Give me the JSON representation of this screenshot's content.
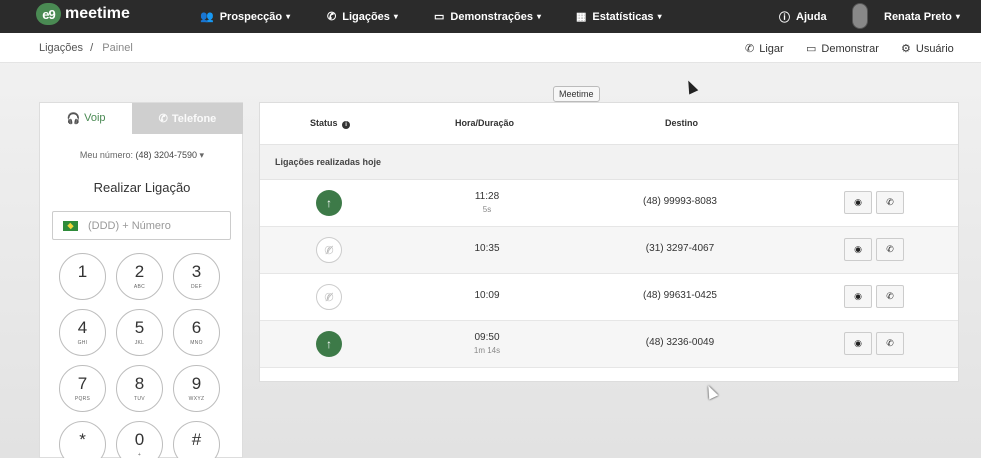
{
  "app": {
    "logo_mark": "e9",
    "logo_text": "meetime"
  },
  "nav": {
    "items": [
      {
        "label": "Prospecção",
        "icon": "users-icon"
      },
      {
        "label": "Ligações",
        "icon": "phone-icon"
      },
      {
        "label": "Demonstrações",
        "icon": "monitor-icon"
      },
      {
        "label": "Estatísticas",
        "icon": "chart-icon"
      }
    ],
    "help": "Ajuda",
    "user": "Renata Preto"
  },
  "breadcrumb": {
    "parent": "Ligações",
    "separator": "/",
    "current": "Painel"
  },
  "actions": {
    "call": "Ligar",
    "demo": "Demonstrar",
    "user": "Usuário"
  },
  "tooltip": "Meetime",
  "dialer": {
    "tabs": [
      {
        "label": "Voip"
      },
      {
        "label": "Telefone"
      }
    ],
    "my_number_label": "Meu número:",
    "my_number": "(48) 3204-7590",
    "title": "Realizar Ligação",
    "input_placeholder": "(DDD) + Número",
    "keys": [
      {
        "digit": "1",
        "letters": ""
      },
      {
        "digit": "2",
        "letters": "ABC"
      },
      {
        "digit": "3",
        "letters": "DEF"
      },
      {
        "digit": "4",
        "letters": "GHI"
      },
      {
        "digit": "5",
        "letters": "JKL"
      },
      {
        "digit": "6",
        "letters": "MNO"
      },
      {
        "digit": "7",
        "letters": "PQRS"
      },
      {
        "digit": "8",
        "letters": "TUV"
      },
      {
        "digit": "9",
        "letters": "WXYZ"
      },
      {
        "digit": "*",
        "letters": ""
      },
      {
        "digit": "0",
        "letters": "+"
      },
      {
        "digit": "#",
        "letters": ""
      }
    ]
  },
  "calls": {
    "headers": {
      "status": "Status",
      "time": "Hora/Duração",
      "destination": "Destino"
    },
    "group_label": "Ligações realizadas hoje",
    "rows": [
      {
        "status": "completed",
        "time": "11:28",
        "duration": "5s",
        "destination": "(48) 99993-8083"
      },
      {
        "status": "missed",
        "time": "10:35",
        "duration": "",
        "destination": "(31) 3297-4067"
      },
      {
        "status": "missed",
        "time": "10:09",
        "duration": "",
        "destination": "(48) 99631-0425"
      },
      {
        "status": "completed",
        "time": "09:50",
        "duration": "1m 14s",
        "destination": "(48) 3236-0049"
      }
    ]
  },
  "colors": {
    "navbar": "#2b2b2b",
    "brand_green": "#4a8a53",
    "status_completed": "#3d7a48"
  }
}
